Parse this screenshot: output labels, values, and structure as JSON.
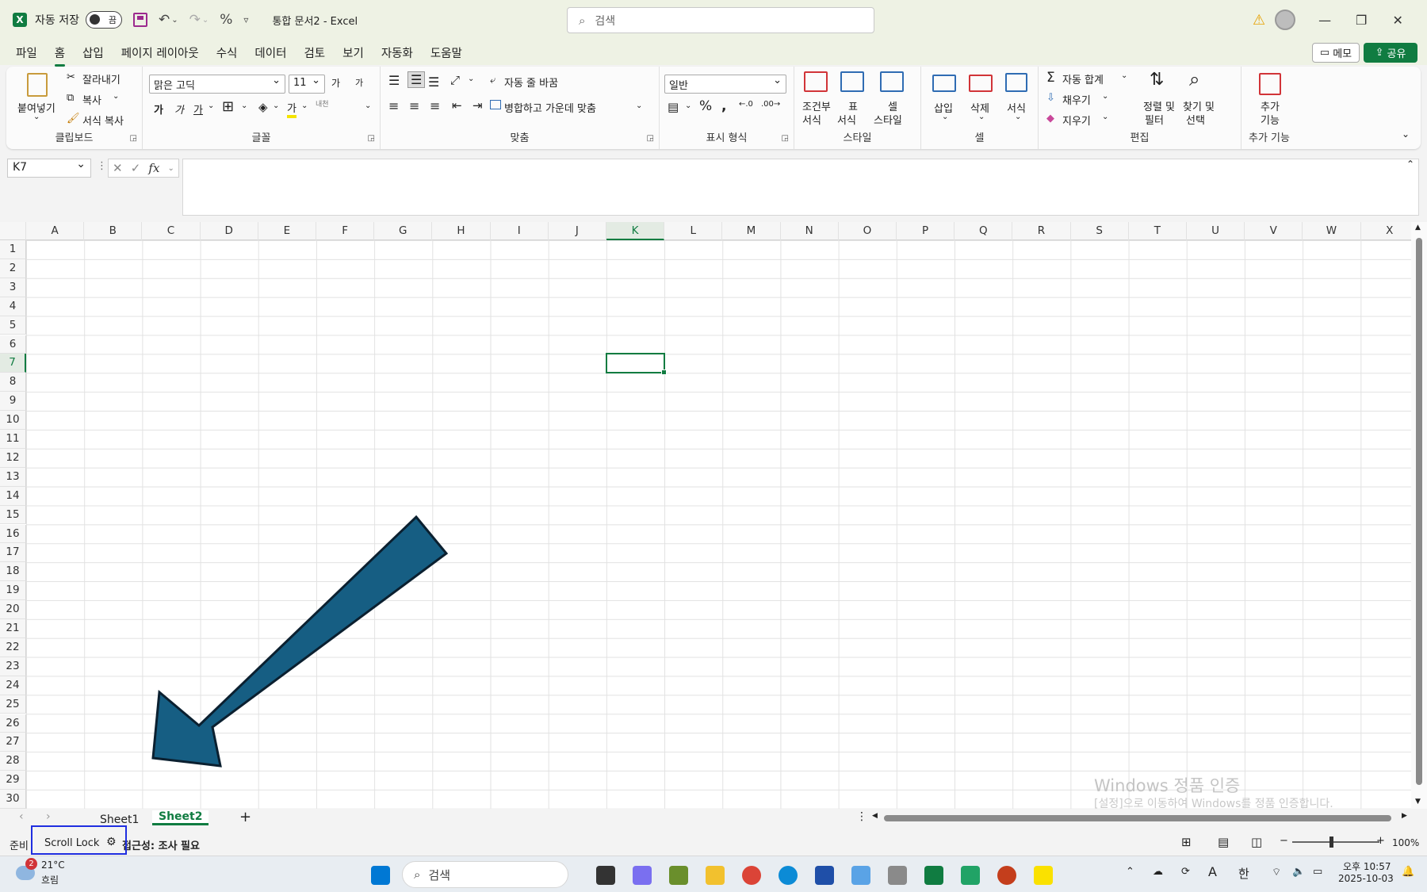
{
  "title_bar": {
    "app_icon": "X",
    "autosave_label": "자동 저장",
    "autosave_state": "끔",
    "doc_title": "통합 문서2  -  Excel",
    "search_placeholder": "검색"
  },
  "menu": {
    "items": [
      "파일",
      "홈",
      "삽입",
      "페이지 레이아웃",
      "수식",
      "데이터",
      "검토",
      "보기",
      "자동화",
      "도움말"
    ],
    "active": "홈",
    "memo_label": "메모",
    "share_label": "공유"
  },
  "ribbon": {
    "clipboard": {
      "paste": "붙여넣기",
      "cut": "잘라내기",
      "copy": "복사",
      "format_painter": "서식 복사",
      "label": "클립보드"
    },
    "font": {
      "font_name": "맑은 고딕",
      "font_size": "11",
      "bold": "가",
      "italic": "가",
      "underline": "가",
      "font_color": "가",
      "phonetic": "내천",
      "grow": "가",
      "shrink": "가",
      "label": "글꼴"
    },
    "alignment": {
      "wrap_text": "자동 줄 바꿈",
      "merge_center": "병합하고 가운데 맞춤",
      "label": "맞춤"
    },
    "number": {
      "format": "일반",
      "label": "표시 형식"
    },
    "styles": {
      "conditional": "조건부\n서식",
      "conditional_1": "조건부",
      "conditional_2": "서식",
      "table_1": "표",
      "table_2": "서식",
      "cell_1": "셀",
      "cell_2": "스타일",
      "label": "스타일"
    },
    "cells": {
      "insert": "삽입",
      "delete": "삭제",
      "format": "서식",
      "label": "셀"
    },
    "editing": {
      "autosum": "자동 합계",
      "fill": "채우기",
      "clear": "지우기",
      "sort_1": "정렬 및",
      "sort_2": "필터",
      "find_1": "찾기 및",
      "find_2": "선택",
      "label": "편집"
    },
    "addins": {
      "addins_1": "추가",
      "addins_2": "기능",
      "label": "추가 기능"
    }
  },
  "formula_bar": {
    "name_box": "K7",
    "fx": "fx",
    "content": ""
  },
  "grid": {
    "columns": [
      "A",
      "B",
      "C",
      "D",
      "E",
      "F",
      "G",
      "H",
      "I",
      "J",
      "K",
      "L",
      "M",
      "N",
      "O",
      "P",
      "Q",
      "R",
      "S",
      "T",
      "U",
      "V",
      "W",
      "X"
    ],
    "rows": [
      "1",
      "2",
      "3",
      "4",
      "5",
      "6",
      "7",
      "8",
      "9",
      "10",
      "11",
      "12",
      "13",
      "14",
      "15",
      "16",
      "17",
      "18",
      "19",
      "20",
      "21",
      "22",
      "23",
      "24",
      "25",
      "26",
      "27",
      "28",
      "29",
      "30"
    ],
    "active_column": "K",
    "active_row": "7",
    "arrow_color": "#165e83"
  },
  "watermark": {
    "line1": "Windows 정품 인증",
    "line2": "[설정]으로 이동하여 Windows를 정품 인증합니다."
  },
  "sheets": {
    "tabs": [
      "Sheet1",
      "Sheet2"
    ],
    "active": "Sheet2",
    "add": "+"
  },
  "status_bar": {
    "ready": "준비",
    "scroll_lock": "Scroll Lock",
    "accessibility": "접근성: 조사 필요",
    "zoom": "100%",
    "highlight_color": "#1f2ee0"
  },
  "taskbar": {
    "weather_temp": "21°C",
    "weather_desc": "흐림",
    "weather_badge": "2",
    "search_placeholder": "검색",
    "time": "오후 10:57",
    "date": "2025-10-03",
    "ime": "한"
  },
  "colors": {
    "accent": "#107c41",
    "title_bg": "#eef2e4"
  }
}
